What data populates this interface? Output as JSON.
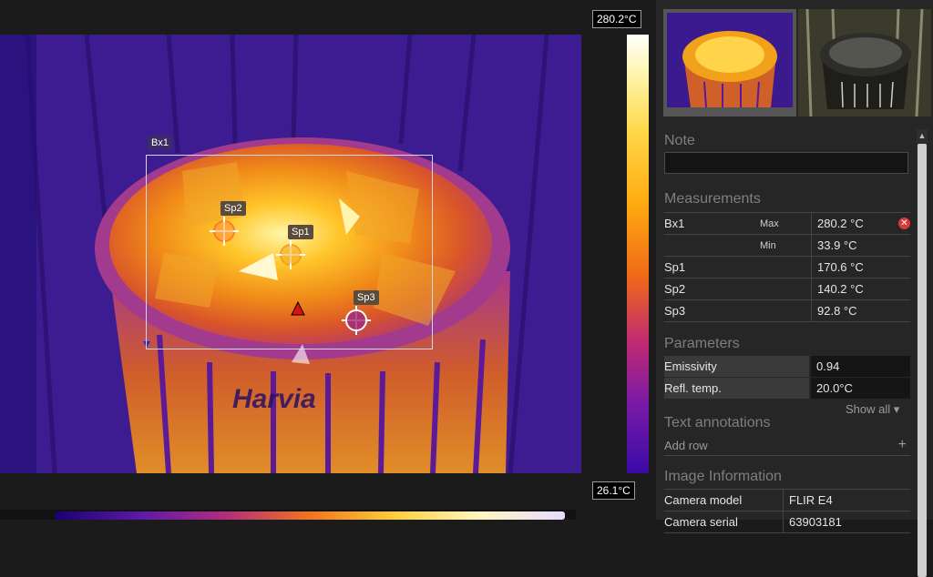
{
  "scale": {
    "max": "280.2°C",
    "min": "26.1°C"
  },
  "image": {
    "box_label": "Bx1",
    "spots": [
      {
        "label": "Sp1",
        "color": "#f2a21a"
      },
      {
        "label": "Sp2",
        "color": "#ff7a30"
      },
      {
        "label": "Sp3",
        "color": "#a0287e"
      }
    ],
    "heater_brand": "Harvia"
  },
  "panel": {
    "note": {
      "title": "Note",
      "value": ""
    },
    "measurements": {
      "title": "Measurements",
      "rows": [
        {
          "name": "Bx1",
          "kind": "Max",
          "value": "280.2 °C"
        },
        {
          "name": "",
          "kind": "Min",
          "value": "33.9 °C"
        },
        {
          "name": "Sp1",
          "kind": "",
          "value": "170.6 °C"
        },
        {
          "name": "Sp2",
          "kind": "",
          "value": "140.2 °C"
        },
        {
          "name": "Sp3",
          "kind": "",
          "value": "92.8 °C"
        }
      ]
    },
    "parameters": {
      "title": "Parameters",
      "rows": [
        {
          "name": "Emissivity",
          "value": "0.94"
        },
        {
          "name": "Refl. temp.",
          "value": "20.0°C"
        }
      ],
      "show_all": "Show all ▾"
    },
    "text_annotations": {
      "title": "Text annotations",
      "add_row": "Add row",
      "add_icon": "+"
    },
    "image_information": {
      "title": "Image Information",
      "rows": [
        {
          "name": "Camera model",
          "value": "FLIR E4"
        },
        {
          "name": "Camera serial",
          "value": "63903181"
        }
      ]
    }
  },
  "colors": {
    "accent_close": "#d63a3a",
    "panel_bg": "#262626"
  }
}
